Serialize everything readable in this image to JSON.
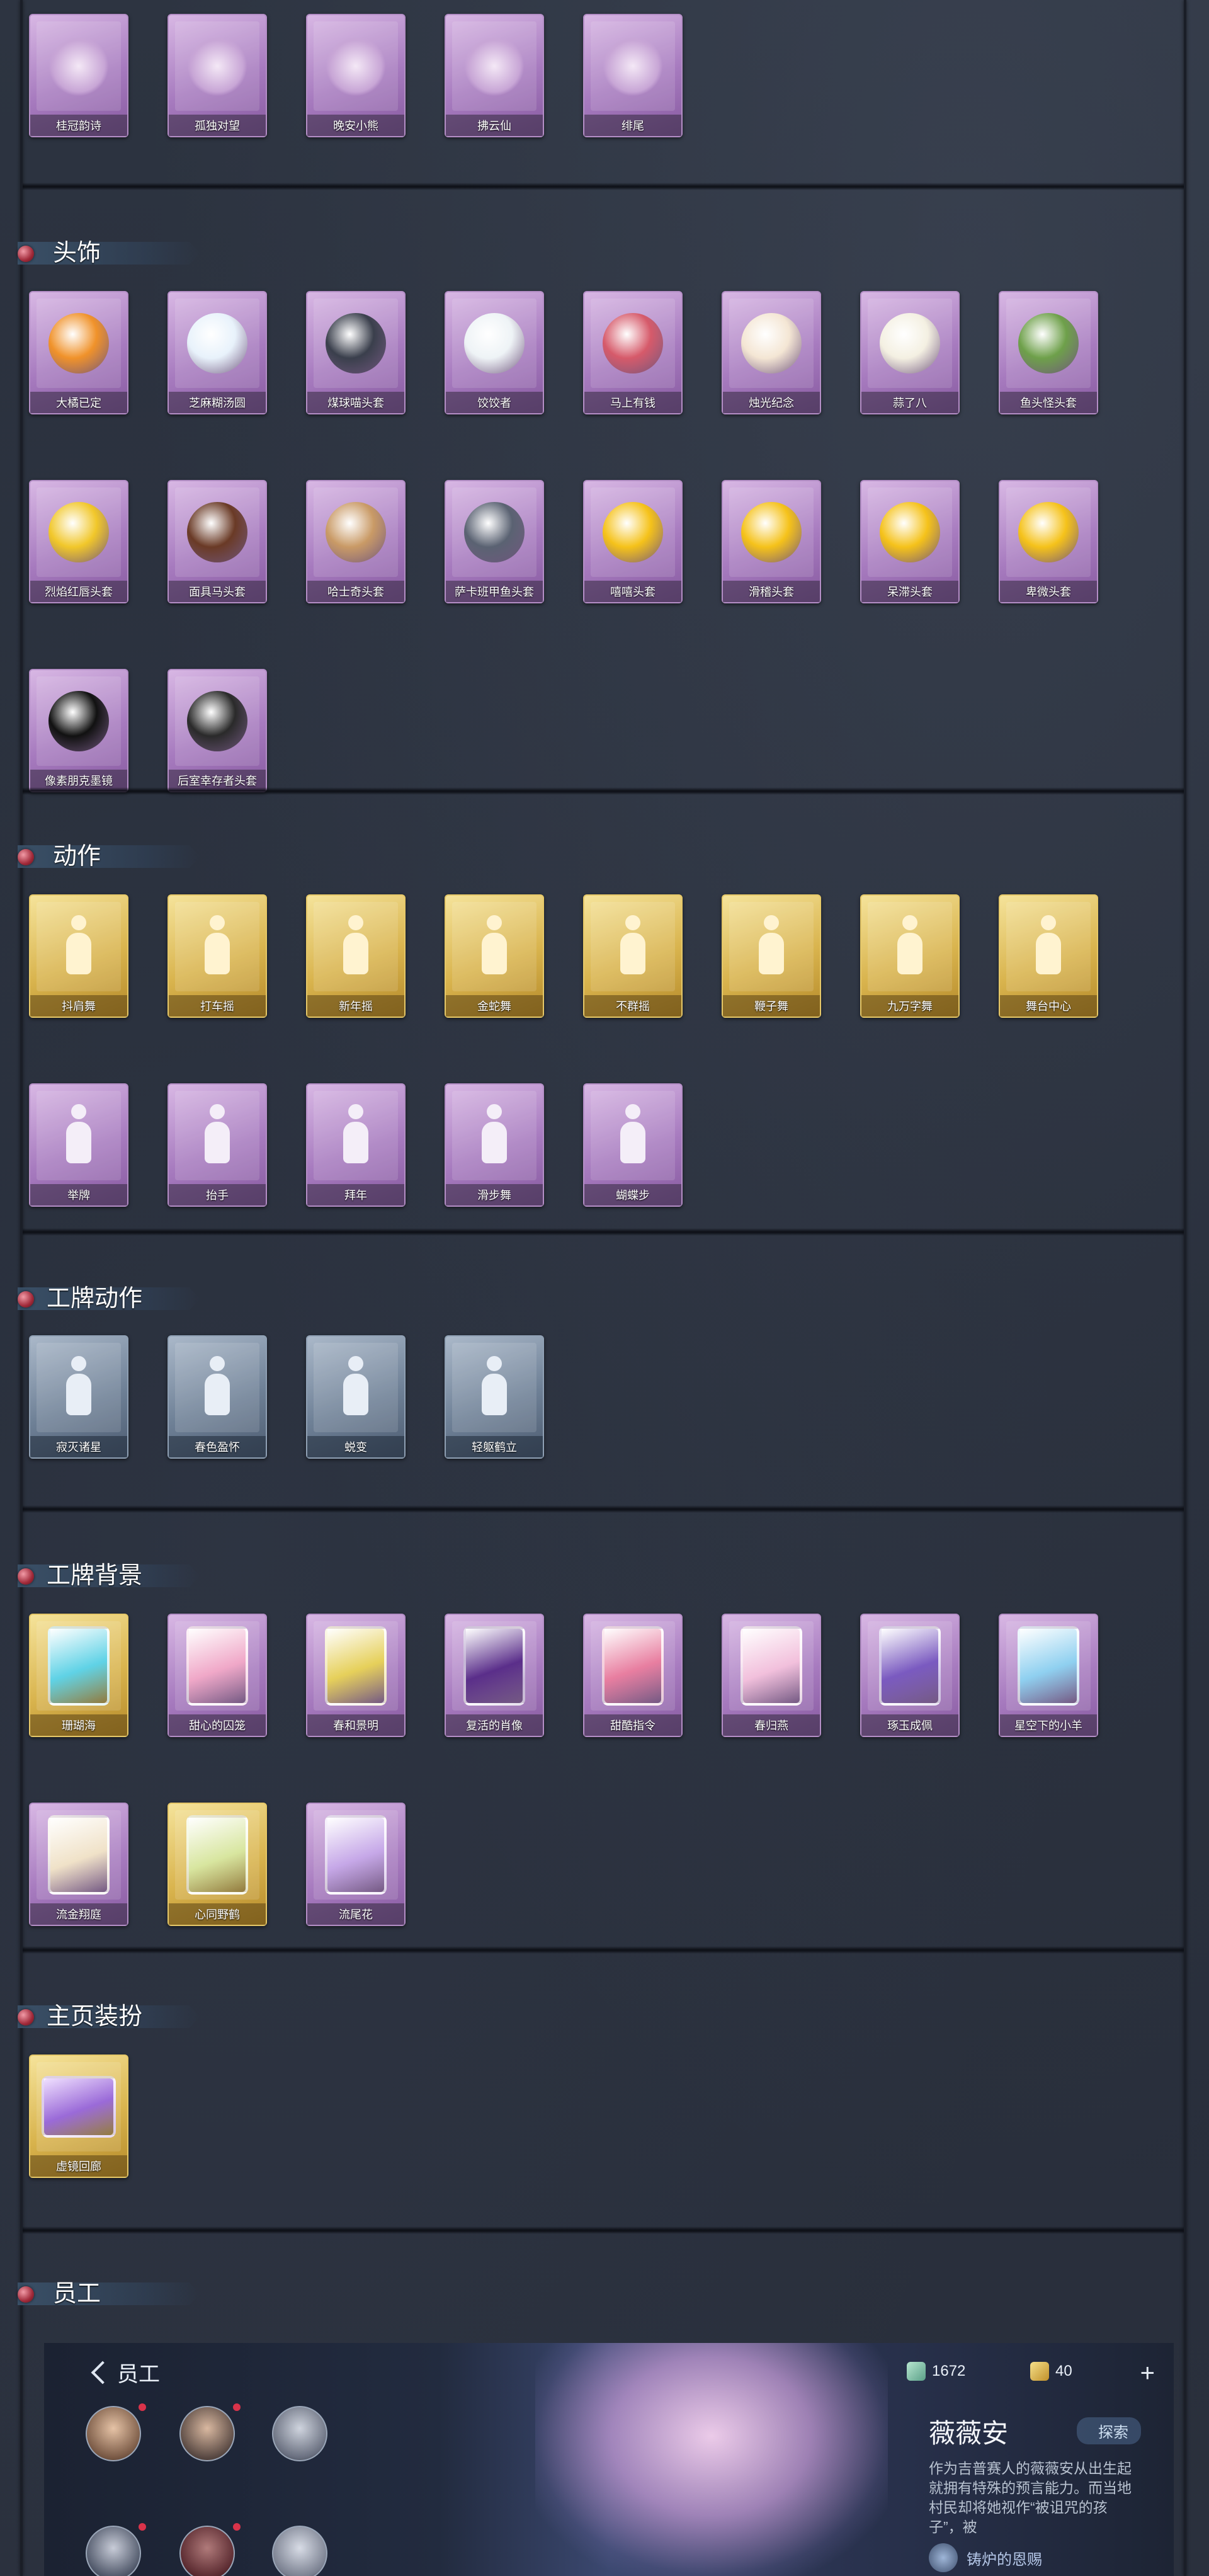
{
  "colors": {
    "background": "#2a303d",
    "purple_card": "#a77bbf",
    "gold_card": "#d9b44e",
    "blue_card": "#6f8197",
    "header_gem": "#a12a3a"
  },
  "top_row": {
    "items": [
      {
        "label": "桂冠韵诗",
        "icon": "flower-doll-pendant"
      },
      {
        "label": "孤独对望",
        "icon": "crystal-pendant"
      },
      {
        "label": "晚安小熊",
        "icon": "bear-pendant"
      },
      {
        "label": "拂云仙",
        "icon": "cloud-fairy-pendant"
      },
      {
        "label": "绯尾",
        "icon": "pink-fox-pendant"
      }
    ]
  },
  "headwear": {
    "title": "头饰",
    "items": [
      {
        "label": "大橘已定",
        "icon": "orange-head",
        "color": "#f0922a"
      },
      {
        "label": "芝麻糊汤圆",
        "icon": "dumpling-head",
        "color": "#e8f2fb"
      },
      {
        "label": "煤球喵头套",
        "icon": "black-cat-head",
        "color": "#3a3f4c"
      },
      {
        "label": "饺饺者",
        "icon": "dumpling-cloud-head",
        "color": "#eef3f6"
      },
      {
        "label": "马上有钱",
        "icon": "horse-head",
        "color": "#d65a6a"
      },
      {
        "label": "烛光纪念",
        "icon": "candle-head",
        "color": "#f4e6d4"
      },
      {
        "label": "蒜了八",
        "icon": "garlic-head",
        "color": "#f4f0e2"
      },
      {
        "label": "鱼头怪头套",
        "icon": "fish-head",
        "color": "#6ea04a"
      },
      {
        "label": "烈焰红唇头套",
        "icon": "pikachu-head",
        "color": "#f1c72a"
      },
      {
        "label": "面具马头套",
        "icon": "horse-mask-head",
        "color": "#6a3a26"
      },
      {
        "label": "哈士奇头套",
        "icon": "husky-head",
        "color": "#c99a66"
      },
      {
        "label": "萨卡班甲鱼头套",
        "icon": "armor-fish-head",
        "color": "#5a6272"
      },
      {
        "label": "嘻嘻头套",
        "icon": "grin-emoji-head",
        "color": "#f5c21a"
      },
      {
        "label": "滑稽头套",
        "icon": "smirk-emoji-head",
        "color": "#f5c21a"
      },
      {
        "label": "呆滞头套",
        "icon": "dazed-emoji-head",
        "color": "#f5c21a"
      },
      {
        "label": "卑微头套",
        "icon": "humble-emoji-head",
        "color": "#f5c21a"
      },
      {
        "label": "像素朋克墨镜",
        "icon": "pixel-sunglasses",
        "color": "#111111"
      },
      {
        "label": "后室幸存者头套",
        "icon": "survivor-helmet",
        "color": "#2a2a2a"
      }
    ]
  },
  "actions": {
    "title": "动作",
    "items": [
      {
        "label": "抖肩舞",
        "style": "gold"
      },
      {
        "label": "打车摇",
        "style": "gold"
      },
      {
        "label": "新年摇",
        "style": "gold"
      },
      {
        "label": "金蛇舞",
        "style": "gold"
      },
      {
        "label": "不群摇",
        "style": "gold"
      },
      {
        "label": "鞭子舞",
        "style": "gold"
      },
      {
        "label": "九万字舞",
        "style": "gold"
      },
      {
        "label": "舞台中心",
        "style": "gold"
      },
      {
        "label": "举牌",
        "style": "purple"
      },
      {
        "label": "抬手",
        "style": "purple"
      },
      {
        "label": "拜年",
        "style": "purple"
      },
      {
        "label": "滑步舞",
        "style": "purple"
      },
      {
        "label": "蝴蝶步",
        "style": "purple"
      }
    ]
  },
  "badge_actions": {
    "title": "工牌动作",
    "items": [
      {
        "label": "寂灭诸星"
      },
      {
        "label": "春色盈怀"
      },
      {
        "label": "蜕变"
      },
      {
        "label": "轻躯鹤立"
      }
    ]
  },
  "badge_backgrounds": {
    "title": "工牌背景",
    "items": [
      {
        "label": "珊瑚海",
        "style": "gold",
        "frame_color": "#5fd2e6"
      },
      {
        "label": "甜心的囚笼",
        "style": "purple",
        "frame_color": "#f0a8c8"
      },
      {
        "label": "春和景明",
        "style": "purple",
        "frame_color": "#e6d05a"
      },
      {
        "label": "复活的肖像",
        "style": "purple",
        "frame_color": "#5a2e8a"
      },
      {
        "label": "甜酷指令",
        "style": "purple",
        "frame_color": "#e87ea0"
      },
      {
        "label": "春归燕",
        "style": "purple",
        "frame_color": "#f2c0dc"
      },
      {
        "label": "琢玉成佩",
        "style": "purple",
        "frame_color": "#7a5ac0"
      },
      {
        "label": "星空下的小羊",
        "style": "purple",
        "frame_color": "#8fd0f0"
      },
      {
        "label": "流金翔庭",
        "style": "purple",
        "frame_color": "#f0e2c8"
      },
      {
        "label": "心同野鹤",
        "style": "gold",
        "frame_color": "#d8e6a0"
      },
      {
        "label": "流尾花",
        "style": "purple",
        "frame_color": "#c6a8e8"
      }
    ]
  },
  "homepage_decor": {
    "title": "主页装扮",
    "items": [
      {
        "label": "虚镜回廊",
        "style": "gold",
        "frame_color": "#9a6ad8"
      }
    ]
  },
  "staff": {
    "title": "员工",
    "back_label": "员工",
    "currency_1": "1672",
    "currency_2": "40",
    "add_label": "+",
    "character_name": "薇薇安",
    "explore_label": "探索",
    "description": "作为吉普赛人的薇薇安从出生起就拥有特殊的预言能力。而当地村民却将她视作“被诅咒的孩子”，被",
    "talent_label": "铸炉的恩赐"
  }
}
